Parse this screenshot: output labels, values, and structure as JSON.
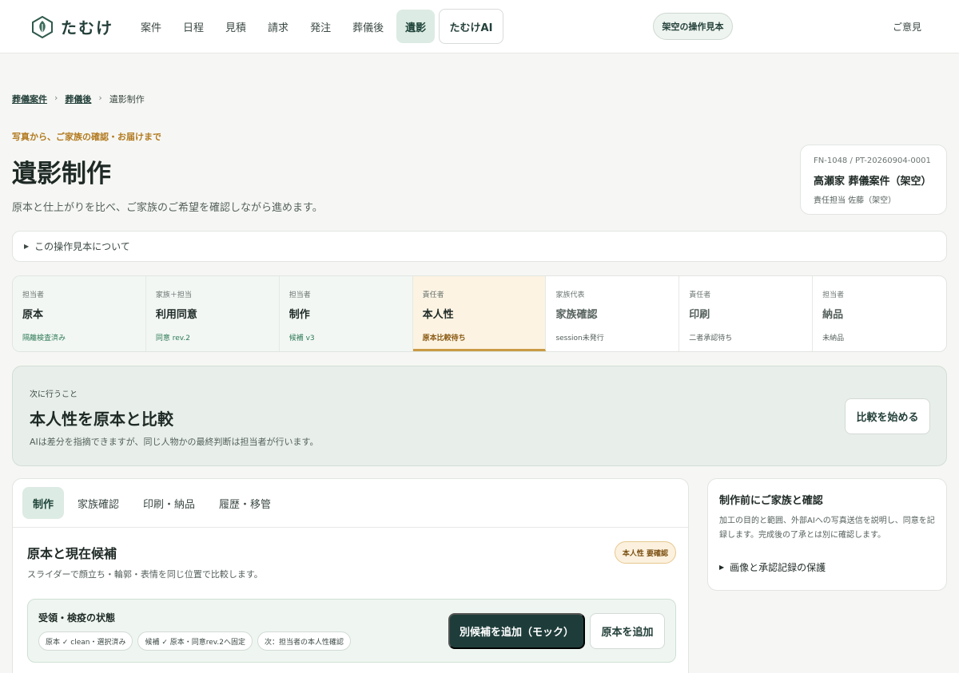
{
  "header": {
    "logo_text": "たむけ",
    "nav": [
      "案件",
      "日程",
      "見積",
      "請求",
      "発注",
      "葬儀後",
      "遺影"
    ],
    "active_nav": "遺影",
    "ai_label": "たむけAI",
    "sample_label": "架空の操作見本",
    "feedback_label": "ご意見"
  },
  "breadcrumb": {
    "items": [
      "葬儀案件",
      "葬儀後"
    ],
    "current": "遺影制作",
    "separator": "›"
  },
  "page": {
    "eyebrow": "写真から、ご家族の確認・お届けまで",
    "title": "遺影制作",
    "subtitle": "原本と仕上がりを比べ、ご家族のご希望を確認しながら進めます。"
  },
  "case_card": {
    "id": "FN-1048 / PT-20260904-0001",
    "name": "高瀬家 葬儀案件（架空）",
    "owner": "責任担当 佐藤（架空）"
  },
  "about": {
    "label": "この操作見本について",
    "toggle": "▶"
  },
  "steps": [
    {
      "role": "担当者",
      "name": "原本",
      "status": "隔離検査済み",
      "state": "done"
    },
    {
      "role": "家族＋担当",
      "name": "利用同意",
      "status": "同意 rev.2",
      "state": "done"
    },
    {
      "role": "担当者",
      "name": "制作",
      "status": "候補 v3",
      "state": "done"
    },
    {
      "role": "責任者",
      "name": "本人性",
      "status": "原本比較待ち",
      "state": "current"
    },
    {
      "role": "家族代表",
      "name": "家族確認",
      "status": "session未発行",
      "state": "todo"
    },
    {
      "role": "責任者",
      "name": "印刷",
      "status": "二者承認待ち",
      "state": "todo"
    },
    {
      "role": "担当者",
      "name": "納品",
      "status": "未納品",
      "state": "todo"
    }
  ],
  "next_action": {
    "eyebrow": "次に行うこと",
    "title": "本人性を原本と比較",
    "description": "AIは差分を指摘できますが、同じ人物かの最終判断は担当者が行います。",
    "button": "比較を始める"
  },
  "main": {
    "tabs": [
      "制作",
      "家族確認",
      "印刷・納品",
      "履歴・移管"
    ],
    "active_tab": "制作",
    "section_title": "原本と現在候補",
    "section_desc": "スライダーで顔立ち・輪郭・表情を同じ位置で比較します。",
    "badge": "本人性 要確認",
    "intake": {
      "title": "受領・検疫の状態",
      "chips": [
        "原本 ✓ clean・選択済み",
        "候補 ✓ 原本・同意rev.2へ固定",
        "次：担当者の本人性確認"
      ],
      "primary_button": "別候補を追加（モック）",
      "secondary_button": "原本を追加"
    }
  },
  "side": {
    "title": "制作前にご家族と確認",
    "description": "加工の目的と範囲、外部AIへの写真送信を説明し、同意を記録します。完成後の了承とは別に確認します。",
    "toggle_label": "画像と承認記録の保護",
    "toggle": "▶"
  },
  "colors": {
    "brand": "#24403a",
    "active_bg": "#dcebe3",
    "accent_warn": "#c99a45",
    "primary_button": "#1e3d3a"
  }
}
